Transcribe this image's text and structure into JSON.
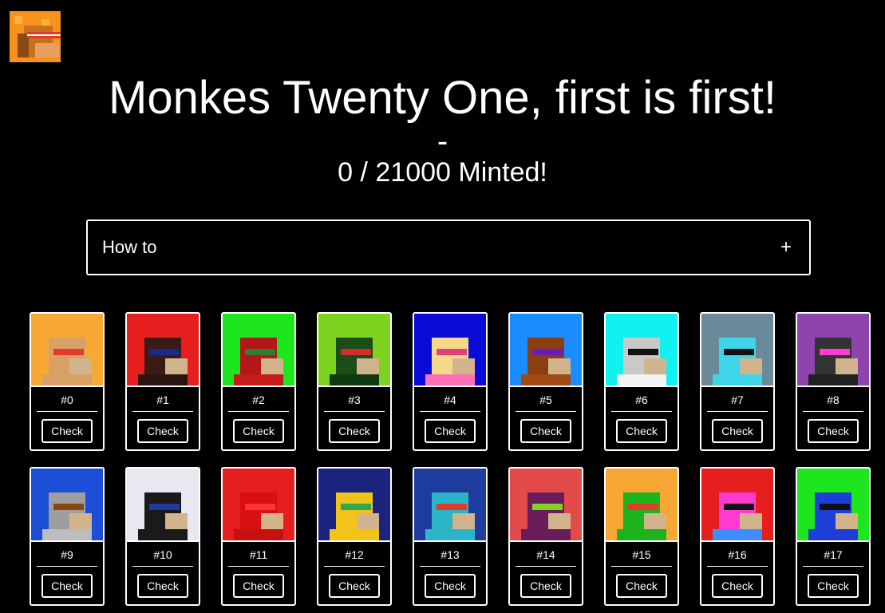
{
  "header": {
    "title": "Monkes Twenty One, first is first!",
    "dash": "-",
    "minted_count": "0",
    "minted_total": "21000",
    "minted_label": "Minted!"
  },
  "howto": {
    "label": "How to",
    "toggle": "+"
  },
  "cards": [
    {
      "number": "#0",
      "button": "Check",
      "bg": "#f7a733",
      "face": "#d9a066",
      "band": "#e23b2e",
      "body": "#d9a066"
    },
    {
      "number": "#1",
      "button": "Check",
      "bg": "#e61e1e",
      "face": "#3a1a14",
      "band": "#1b2a8a",
      "body": "#2b1410"
    },
    {
      "number": "#2",
      "button": "Check",
      "bg": "#1ee61e",
      "face": "#b31717",
      "band": "#2e7d32",
      "body": "#c61b1b"
    },
    {
      "number": "#3",
      "button": "Check",
      "bg": "#7ed321",
      "face": "#1a4d1a",
      "band": "#d62b2b",
      "body": "#0f3a0f"
    },
    {
      "number": "#4",
      "button": "Check",
      "bg": "#0b0bd8",
      "face": "#f5d98a",
      "band": "#e0417b",
      "body": "#ff6fb5"
    },
    {
      "number": "#5",
      "button": "Check",
      "bg": "#1a8cff",
      "face": "#8b3e0f",
      "band": "#6a1bb5",
      "body": "#a34a12"
    },
    {
      "number": "#6",
      "button": "Check",
      "bg": "#12f0f0",
      "face": "#c9c9c9",
      "band": "#111111",
      "body": "#f2f2f2"
    },
    {
      "number": "#7",
      "button": "Check",
      "bg": "#6b8a99",
      "face": "#3fd4e8",
      "band": "#111111",
      "body": "#3fd4e8"
    },
    {
      "number": "#8",
      "button": "Check",
      "bg": "#8e44ad",
      "face": "#333333",
      "band": "#ff3bd4",
      "body": "#222222"
    },
    {
      "number": "#9",
      "button": "Check",
      "bg": "#1d4ed8",
      "face": "#9e9e9e",
      "band": "#8b4513",
      "body": "#bdbdbd"
    },
    {
      "number": "#10",
      "button": "Check",
      "bg": "#e8e8f0",
      "face": "#1a1a1a",
      "band": "#1e3a9a",
      "body": "#1a1a1a"
    },
    {
      "number": "#11",
      "button": "Check",
      "bg": "#e61e1e",
      "face": "#d81010",
      "band": "#ff3333",
      "body": "#c81010"
    },
    {
      "number": "#12",
      "button": "Check",
      "bg": "#1a237e",
      "face": "#f2c318",
      "band": "#2ea84e",
      "body": "#f2c318"
    },
    {
      "number": "#13",
      "button": "Check",
      "bg": "#1e3c9e",
      "face": "#2bb5c6",
      "band": "#e23b2e",
      "body": "#2bb5c6"
    },
    {
      "number": "#14",
      "button": "Check",
      "bg": "#e34b4b",
      "face": "#6a1b5a",
      "band": "#7ed321",
      "body": "#6a1b5a"
    },
    {
      "number": "#15",
      "button": "Check",
      "bg": "#f7a733",
      "face": "#1db31d",
      "band": "#e23b2e",
      "body": "#1db31d"
    },
    {
      "number": "#16",
      "button": "Check",
      "bg": "#e61e1e",
      "face": "#ff3bd4",
      "band": "#111111",
      "body": "#3f8cff"
    },
    {
      "number": "#17",
      "button": "Check",
      "bg": "#1ee61e",
      "face": "#1d3fd8",
      "band": "#111111",
      "body": "#1d3fd8"
    }
  ]
}
